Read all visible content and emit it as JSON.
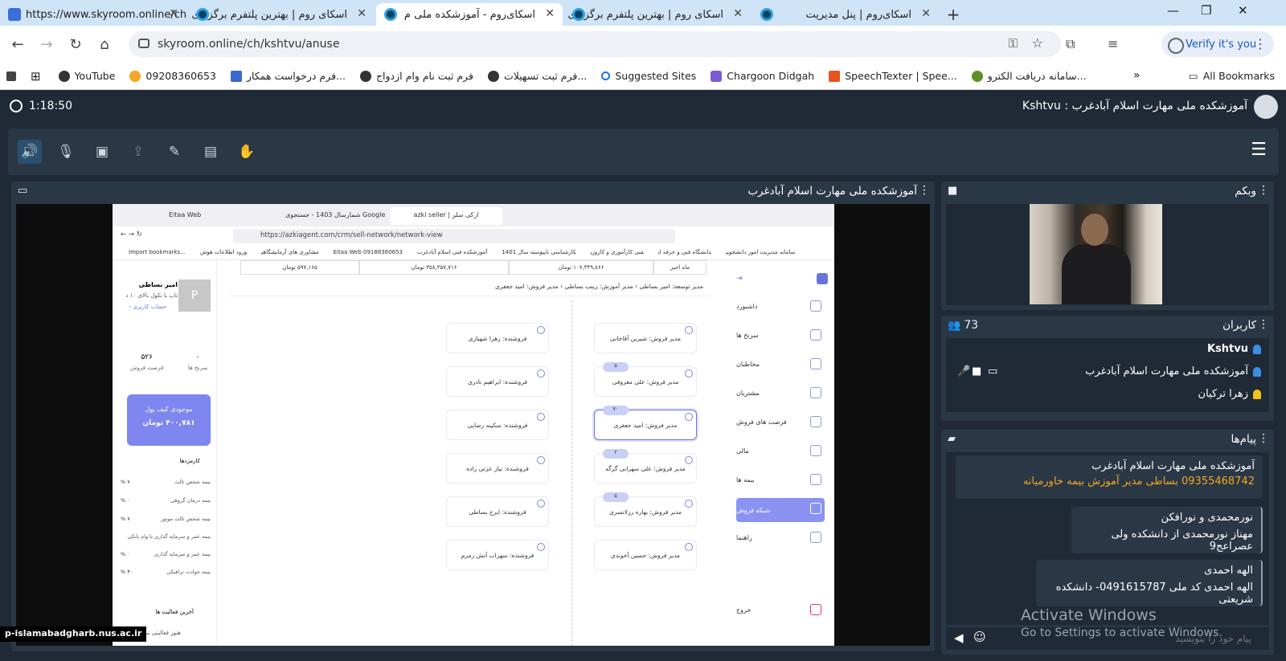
{
  "browser": {
    "tabs": [
      {
        "label": "https://www.skyroom.online/ch",
        "active": false
      },
      {
        "label": "اسکای روم | بهترین پلتفرم برگزاری",
        "active": false
      },
      {
        "label": "اسکای‌روم - آموزشکده ملی م",
        "active": true
      },
      {
        "label": "اسکای روم | بهترین پلتفرم برگزاری",
        "active": false
      },
      {
        "label": "اسکای‌روم | پنل مدیریت",
        "active": false
      }
    ],
    "url": "skyroom.online/ch/kshtvu/anuse",
    "verify_label": "Verify it's you",
    "bookmarks": [
      "YouTube",
      "09208360653",
      "فرم درخواست همکار...",
      "فرم ثبت نام وام ازدواج",
      "فرم ثبت تسهیلات...",
      "Suggested Sites",
      "Chargoon Didgah",
      "SpeechTexter | Spee...",
      "سامانه دریافت الکترو..."
    ],
    "all_bookmarks": "All Bookmarks"
  },
  "room": {
    "timer": "1:18:50",
    "title": "Kshtvu : آموزشکده ملی مهارت اسلام آبادغرب",
    "share_title": "آموزشکده ملی مهارت اسلام آبادغرب",
    "webcam_title": "وبکم",
    "users_title": "کاربران",
    "users_count": "73",
    "messages_title": "پیام‌ها",
    "users": [
      "Kshtvu",
      "آموزشکده ملی مهارت اسلام آبادغرب",
      "زهرا ترکیان"
    ],
    "messages": [
      {
        "l1": "آموزشکده ملی مهارت اسلام آبادغرب",
        "l2": "09355468742 بساطی مدیر آموزش بیمه خاورمیانه"
      },
      {
        "l1": "نورمحمدی و نورافکن",
        "l2": "مهناز نورمحمدی   از دانشکده ولی عصراعج9"
      },
      {
        "l1": "الهه احمدی",
        "l2": "الهه احمدی کد ملی 0491615787- دانشکده شریعتی"
      }
    ],
    "input_placeholder": "پیام خود را بنویسید"
  },
  "shared": {
    "tabs": [
      "Eitaa Web",
      "شمارسال 1403 - جستجوی Google",
      "azki seller | ازکی سلر"
    ],
    "url": "https://azkiagent.com/crm/sell-network/network-view",
    "bookmarks": [
      "Import bookmarks...",
      "مشاوری های آزمایشگاهی",
      "ورود اطلاعات هوش",
      "Eitaa Web 09188360653",
      "سامانه مدیریت امور دانشجویی",
      "دانشگاه فنی و حرفه ای",
      "فنی کارآموزی و کاروزی",
      "کارشناسی ناپیوسته سال 1401",
      "آموزشکده فنی اسلام آبادغرب"
    ],
    "stats": [
      "ماه اخیر",
      "۱۰۷,۳۴۹,۸۶۶ تومان",
      "۳۵۸,۳۵۷,۷۱۶ تومان",
      "۵۹۷,۱۶۵ تومان"
    ],
    "breadcrumb": "مدیر توسعه: امیر بساطی   ›   مدیر آموزش: زینب بساطی   ›   مدیر فروش: امید جعفری",
    "nav": [
      "داشبورد",
      "سرنخ ها",
      "مخاطبان",
      "مشتریان",
      "فرصت های فروش",
      "مالی",
      "بیمه ها",
      "شبکه فروش",
      "راهنما",
      "خروج"
    ],
    "managers": [
      "مدیر فروش: شیرین آقاخانی",
      "مدیر فروش: علی معروفی",
      "مدیر فروش: امید جعفری",
      "مدیر فروش: علی سهرابی گرگه",
      "مدیر فروش: بهاره رزلانسری",
      "مدیر فروش: حسین آخوندی"
    ],
    "manager_pills": [
      "",
      "۵",
      "۷۰",
      "۲",
      "۵",
      ""
    ],
    "sellers": [
      "فروشنده: زهرا شهبازی",
      "فروشنده: ابراهیم نادری",
      "فروشنده: سکینه رضایی",
      "فروشنده: نیاز عزتی زاده",
      "فروشنده: ایرج بساطی",
      "فروشنده: سهراب آتش زمزم"
    ],
    "profile_name": "امیر بساطی",
    "profile_sub": "ثاپ با نکول بالای ۱۰ د",
    "profile_link": "حساب کاربری ›",
    "profile_avatar": "P",
    "count_leads": "۰",
    "count_leads_label": "سرنخ ها",
    "count_opps": "۵۲۶",
    "count_opps_label": "فرصت فروش",
    "wallet_label": "موجودی کیف پول",
    "wallet_value": "۴۰۰,۷۸۱ تومان",
    "commissions_label": "کارمزدها",
    "insurance": [
      {
        "name": "بیمه شخص ثالث",
        "pct": "۷ %"
      },
      {
        "name": "بیمه درمان گروهی",
        "pct": "۰ %"
      },
      {
        "name": "بیمه شخص ثالث موتور",
        "pct": "۷ %"
      },
      {
        "name": "بیمه عمر و سرمایه گذاری با وام بانکی",
        "pct": ""
      },
      {
        "name": "بیمه عمر و سرمایه گذاری",
        "pct": "۰ %"
      },
      {
        "name": "بیمه حوادث ترافیکی",
        "pct": "۳۰ %"
      }
    ],
    "last_activity": "آخرین فعالیت ها",
    "no_activity": "هنوز فعالیتی ثبت نشده."
  },
  "os": {
    "activate_title": "Activate Windows",
    "activate_sub": "Go to Settings to activate Windows.",
    "watermark": "p-islamabadgharb.nus.ac.ir"
  }
}
